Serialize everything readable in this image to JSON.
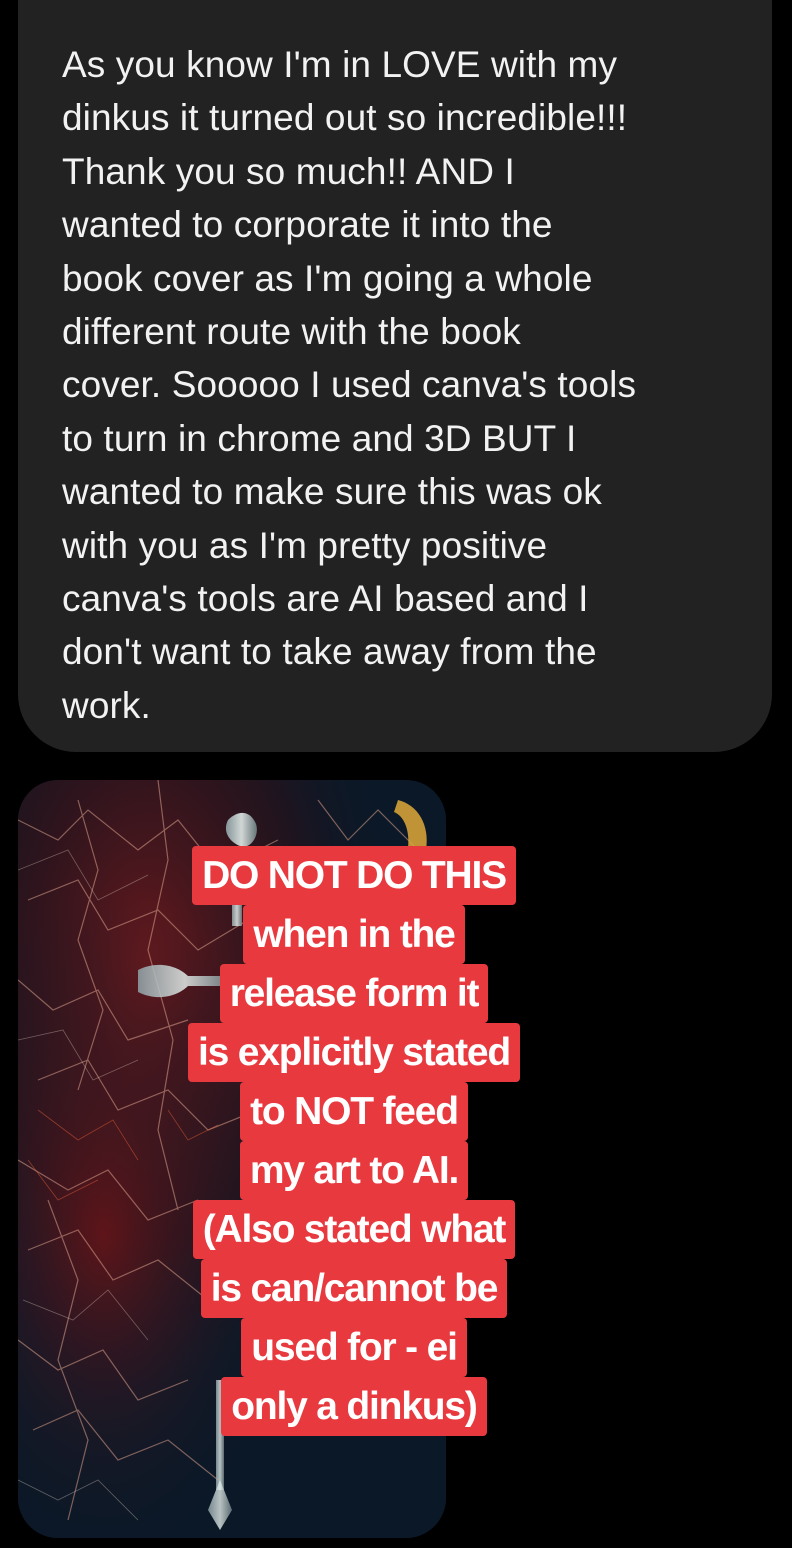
{
  "message": {
    "lines": [
      "As you know I'm in LOVE with my",
      "dinkus it turned out so incredible!!!",
      "Thank you so much!! AND I",
      "wanted to corporate it into the",
      "book cover as I'm going a whole",
      "different route with the book",
      "cover. Sooooo I used canva's tools",
      "to turn in chrome and 3D BUT I",
      "wanted to make sure this was ok",
      "with you as I'm pretty positive",
      "canva's tools are AI based and I",
      "don't want to take away from the",
      "work."
    ]
  },
  "overlay_caption": {
    "lines": [
      "DO NOT DO THIS",
      "when in the",
      "release form it",
      "is explicitly stated",
      "to NOT feed",
      "my art to AI.",
      "(Also stated what",
      "is can/cannot be",
      "used for - ei",
      "only a dinkus)"
    ]
  },
  "colors": {
    "background": "#000000",
    "bubble": "#222222",
    "bubble_text": "#f2f2f2",
    "caption_highlight": "#e8393f",
    "caption_text": "#ffffff"
  }
}
